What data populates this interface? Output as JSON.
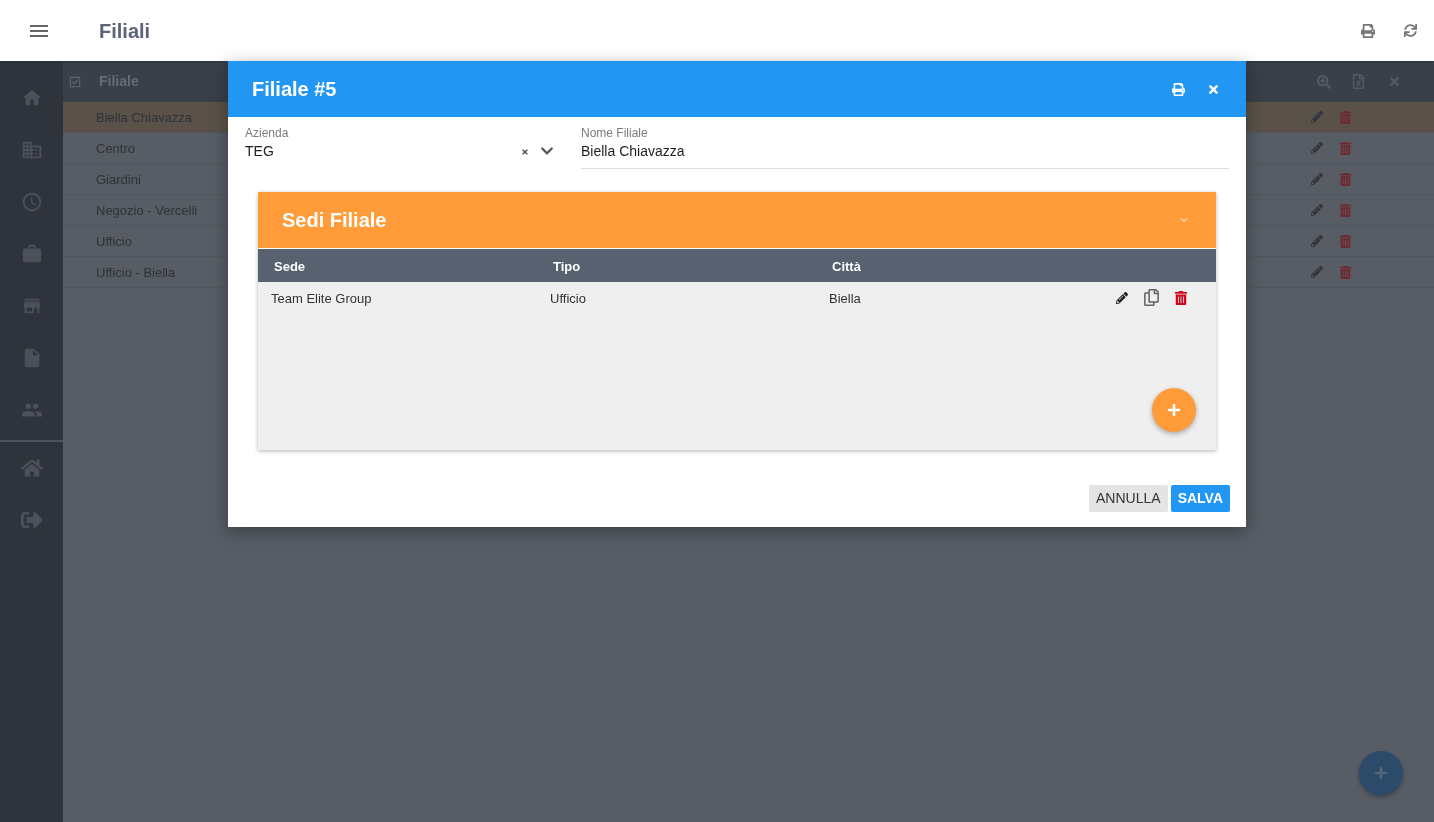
{
  "top_bar": {
    "title": "Filiali"
  },
  "list": {
    "header": "Filiale",
    "rows": [
      {
        "name": "Biella Chiavazza",
        "selected": true
      },
      {
        "name": "Centro",
        "selected": false
      },
      {
        "name": "Giardini",
        "selected": false
      },
      {
        "name": "Negozio - Vercelli",
        "selected": false
      },
      {
        "name": "Ufficio",
        "selected": false
      },
      {
        "name": "Ufficio - Biella",
        "selected": false
      }
    ]
  },
  "dialog": {
    "title": "Filiale #5",
    "fields": [
      {
        "kind": "select",
        "label": "Azienda",
        "value": "TEG"
      },
      {
        "kind": "text",
        "label": "Nome Filiale",
        "value": "Biella Chiavazza"
      }
    ],
    "panel": {
      "title": "Sedi Filiale",
      "columns": [
        "Sede",
        "Tipo",
        "Città"
      ],
      "rows": [
        {
          "cells": [
            "Team Elite Group",
            "Ufficio",
            "Biella"
          ]
        }
      ]
    },
    "buttons": [
      {
        "kind": "secondary",
        "label": "ANNULLA"
      },
      {
        "kind": "primary",
        "label": "SALVA"
      }
    ]
  }
}
